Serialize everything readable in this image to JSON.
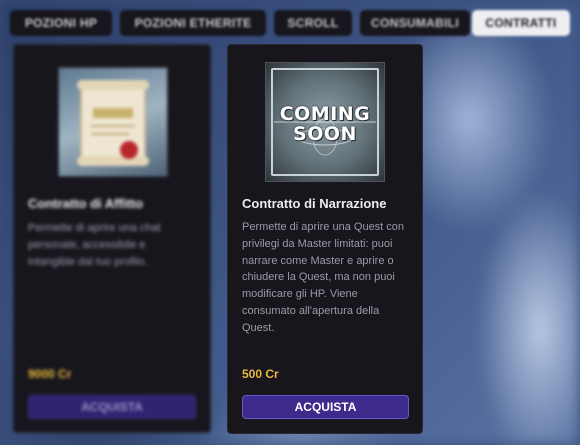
{
  "tabs": [
    {
      "label": "Pozioni HP",
      "active": false
    },
    {
      "label": "Pozioni Etherite",
      "active": false
    },
    {
      "label": "Scroll",
      "active": false
    },
    {
      "label": "Consumabili",
      "active": false
    },
    {
      "label": "Contratti",
      "active": true
    }
  ],
  "cards": [
    {
      "title": "Contratto di Affitto",
      "description": "Permette di aprire una chat personale, accessibile e intangible dal tuo profilo.",
      "price": "9000 Cr",
      "button_label": "ACQUISTA",
      "image": "scroll-contract-icon"
    },
    {
      "title": "Contratto di Narrazione",
      "description": "Permette di aprire una Quest con privilegi da Master limitati: puoi narrare come Master e aprire o chiudere la Quest, ma non puoi modificare gli HP. Viene consumato all'apertura della Quest.",
      "price": "500 Cr",
      "button_label": "ACQUISTA",
      "image": "coming-soon-badge",
      "image_text": [
        "COMING",
        "SOON"
      ]
    }
  ],
  "colors": {
    "card_bg": "#17161d",
    "price": "#e8b83c",
    "button_bg": "#3d2a8c",
    "button_border": "#6a58c6",
    "active_tab": "#efeff2"
  }
}
